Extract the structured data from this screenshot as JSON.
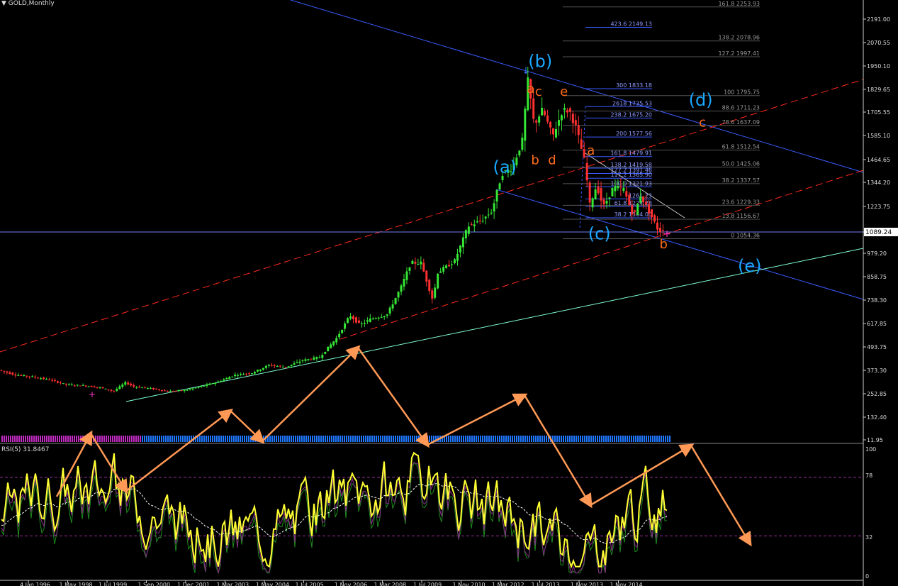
{
  "window": {
    "title": "GOLD,Monthly",
    "menu_icon": "triangle-down-icon"
  },
  "rsi": {
    "title": "RSI(5) 31.8467",
    "levels": [
      "100",
      "78",
      "32",
      "0"
    ]
  },
  "colors": {
    "background": "#000000",
    "bull": "#35e635",
    "bear": "#ff3030",
    "channel_blue": "#3a5cff",
    "channel_red": "#ff2a1a",
    "support_green": "#7fffd0",
    "wave_cyan": "#1aa7ff",
    "wave_orange": "#ff6a1a",
    "arrow_orange": "#ff9955",
    "rsi_line": "#ffff33",
    "fib_text": "#9a9a9a"
  },
  "chart_data": {
    "type": "candlestick",
    "symbol": "GOLD",
    "timeframe": "Monthly",
    "price_scale": [
      "2191.00",
      "2070.55",
      "1950.10",
      "1829.65",
      "1705.55",
      "1585.10",
      "1464.65",
      "1344.20",
      "1223.75",
      "1089.24",
      "979.20",
      "858.75",
      "738.30",
      "617.85",
      "493.75",
      "373.30",
      "252.85",
      "132.40",
      "11.95"
    ],
    "current_price": "1089.24",
    "price_path": [
      [
        1996.0,
        375
      ],
      [
        1996.5,
        350
      ],
      [
        1997.0,
        340
      ],
      [
        1997.5,
        325
      ],
      [
        1998.0,
        300
      ],
      [
        1998.5,
        295
      ],
      [
        1999.0,
        285
      ],
      [
        1999.4,
        265
      ],
      [
        1999.75,
        310
      ],
      [
        2000.0,
        290
      ],
      [
        2000.5,
        280
      ],
      [
        2001.0,
        265
      ],
      [
        2001.5,
        270
      ],
      [
        2002.0,
        290
      ],
      [
        2002.5,
        315
      ],
      [
        2003.0,
        350
      ],
      [
        2003.5,
        360
      ],
      [
        2004.0,
        400
      ],
      [
        2004.5,
        390
      ],
      [
        2005.0,
        425
      ],
      [
        2005.5,
        440
      ],
      [
        2006.0,
        540
      ],
      [
        2006.4,
        660
      ],
      [
        2006.7,
        610
      ],
      [
        2007.0,
        640
      ],
      [
        2007.5,
        665
      ],
      [
        2007.9,
        800
      ],
      [
        2008.2,
        930
      ],
      [
        2008.5,
        930
      ],
      [
        2008.85,
        740
      ],
      [
        2009.0,
        880
      ],
      [
        2009.5,
        940
      ],
      [
        2009.9,
        1120
      ],
      [
        2010.3,
        1150
      ],
      [
        2010.6,
        1200
      ],
      [
        2010.9,
        1390
      ],
      [
        2011.2,
        1420
      ],
      [
        2011.5,
        1560
      ],
      [
        2011.67,
        1880
      ],
      [
        2011.85,
        1640
      ],
      [
        2012.1,
        1720
      ],
      [
        2012.4,
        1580
      ],
      [
        2012.7,
        1720
      ],
      [
        2012.9,
        1710
      ],
      [
        2013.1,
        1620
      ],
      [
        2013.35,
        1450
      ],
      [
        2013.5,
        1230
      ],
      [
        2013.7,
        1330
      ],
      [
        2013.9,
        1220
      ],
      [
        2014.2,
        1320
      ],
      [
        2014.5,
        1310
      ],
      [
        2014.8,
        1170
      ],
      [
        2015.0,
        1280
      ],
      [
        2015.3,
        1180
      ],
      [
        2015.55,
        1090
      ],
      [
        2015.7,
        1110
      ]
    ],
    "fib_levels_right": [
      {
        "label": "161.8 2253.93",
        "price": 2253.93
      },
      {
        "label": "138.2 2078.96",
        "price": 2078.96
      },
      {
        "label": "127.2 1997.41",
        "price": 1997.41
      },
      {
        "label": "100 1795.75",
        "price": 1795.75
      },
      {
        "label": "88.6 1711.23",
        "price": 1711.23
      },
      {
        "label": "78.6 1637.09",
        "price": 1637.09
      },
      {
        "label": "61.8 1512.54",
        "price": 1512.54
      },
      {
        "label": "50.0 1425.06",
        "price": 1425.06
      },
      {
        "label": "38.2 1337.57",
        "price": 1337.57
      },
      {
        "label": "23.6 1229.33",
        "price": 1229.33
      },
      {
        "label": "13.8 1156.67",
        "price": 1156.67
      },
      {
        "label": "0 1054.36",
        "price": 1054.36
      }
    ],
    "fib_levels_left": [
      {
        "label": "423.6 2149.13",
        "price": 2149.13
      },
      {
        "label": "300 1833.18",
        "price": 1833.18
      },
      {
        "label": "2618 1735.53",
        "price": 1735.53
      },
      {
        "label": "238.2 1675.20",
        "price": 1675.2
      },
      {
        "label": "200 1577.56",
        "price": 1577.56
      },
      {
        "label": "161.8 1479.91",
        "price": 1479.91
      },
      {
        "label": "138.2 1419.58",
        "price": 1419.58
      },
      {
        "label": "127.2 1391.46",
        "price": 1391.46
      },
      {
        "label": "117.2 1365.90",
        "price": 1365.9
      },
      {
        "label": "100.0 1321.93",
        "price": 1321.93
      },
      {
        "label": "1261.23",
        "price": 1261.23
      },
      {
        "label": "61.8 1224.28",
        "price": 1224.28
      },
      {
        "label": "38.2 1164.00",
        "price": 1164
      }
    ],
    "wave_labels": [
      {
        "text": "(a)",
        "color": "cyan",
        "t": 2010.9,
        "price": 1395
      },
      {
        "text": "(b)",
        "color": "cyan",
        "t": 2011.95,
        "price": 1945
      },
      {
        "text": "(c)",
        "color": "cyan",
        "t": 2013.7,
        "price": 1050
      },
      {
        "text": "(d)",
        "color": "cyan",
        "t": 2016.7,
        "price": 1740
      },
      {
        "text": "(e)",
        "color": "cyan",
        "t": 2018.15,
        "price": 885
      },
      {
        "text": "a",
        "color": "orange",
        "t": 2011.67,
        "price": 1810
      },
      {
        "text": "c",
        "color": "orange",
        "t": 2011.9,
        "price": 1795
      },
      {
        "text": "e",
        "color": "orange",
        "t": 2012.65,
        "price": 1795
      },
      {
        "text": "b",
        "color": "orange",
        "t": 2011.8,
        "price": 1440
      },
      {
        "text": "d",
        "color": "orange",
        "t": 2012.3,
        "price": 1440
      },
      {
        "text": "a",
        "color": "orange",
        "t": 2013.45,
        "price": 1490
      },
      {
        "text": "c",
        "color": "orange",
        "t": 2016.75,
        "price": 1630
      },
      {
        "text": "b",
        "color": "orange",
        "t": 2015.6,
        "price": 1005
      }
    ],
    "x_labels": [
      "4 Jan 1996",
      "1 May 1998",
      "1 Jul 1999",
      "1 Sep 2000",
      "1 Dec 2001",
      "1 Mar 2003",
      "1 May 2004",
      "1 Jul 2005",
      "1 Nov 2006",
      "1 Mar 2008",
      "1 Jul 2009",
      "1 Nov 2010",
      "1 Mar 2012",
      "1 Jul 2013",
      "1 Nov 2013",
      "1 Nov 2014"
    ]
  }
}
